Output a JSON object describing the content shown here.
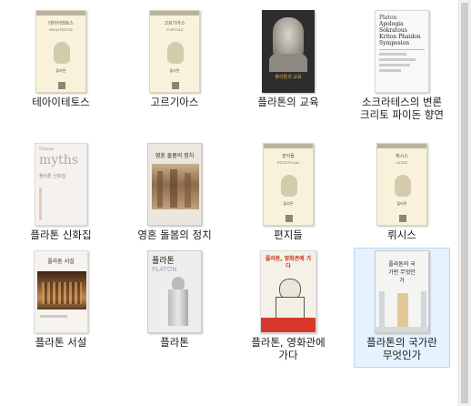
{
  "items": [
    {
      "label": "테아이테토스",
      "cover": {
        "title": "테아이테토스",
        "subtitle": "ΘΕΑΙΤΗΤΟΣ",
        "author": "플라톤"
      }
    },
    {
      "label": "고르기아스",
      "cover": {
        "title": "고르기아스",
        "subtitle": "ΓΟΡΓΙΑΣ",
        "author": "플라톤"
      }
    },
    {
      "label": "플라톤의 교육",
      "cover": {
        "title": "플라톤의 교육"
      }
    },
    {
      "label": "소크라테스의 변론 크리토 파이돈 향연",
      "cover": {
        "author": "Platon",
        "title": "Apologia Sokratous Kriton Phaidon Symposion"
      }
    },
    {
      "label": "플라톤 신화집",
      "cover": {
        "header": "Platon",
        "title": "myths",
        "subtitle": "플라톤 신화집"
      }
    },
    {
      "label": "영혼 돌봄의 정치",
      "cover": {
        "title": "영혼 돌봄의 정치"
      }
    },
    {
      "label": "편지들",
      "cover": {
        "title": "편지들",
        "subtitle": "ΕΠΙΣΤΟΛΑΙ",
        "author": "플라톤"
      }
    },
    {
      "label": "뤼시스",
      "cover": {
        "title": "뤼시스",
        "subtitle": "ΛΥΣΙΣ",
        "author": "플라톤"
      }
    },
    {
      "label": "플라톤 서설",
      "cover": {
        "title": "플라톤 서설"
      }
    },
    {
      "label": "플라톤",
      "cover": {
        "title": "플라톤",
        "subtitle": "PLATON"
      }
    },
    {
      "label": "플라톤, 영화관에 가다",
      "cover": {
        "title": "플라톤, 영화관에 가다"
      }
    },
    {
      "label": "플라톤의 국가란 무엇인가",
      "cover": {
        "title": "플라톤의 국가란 무엇인가"
      }
    }
  ]
}
